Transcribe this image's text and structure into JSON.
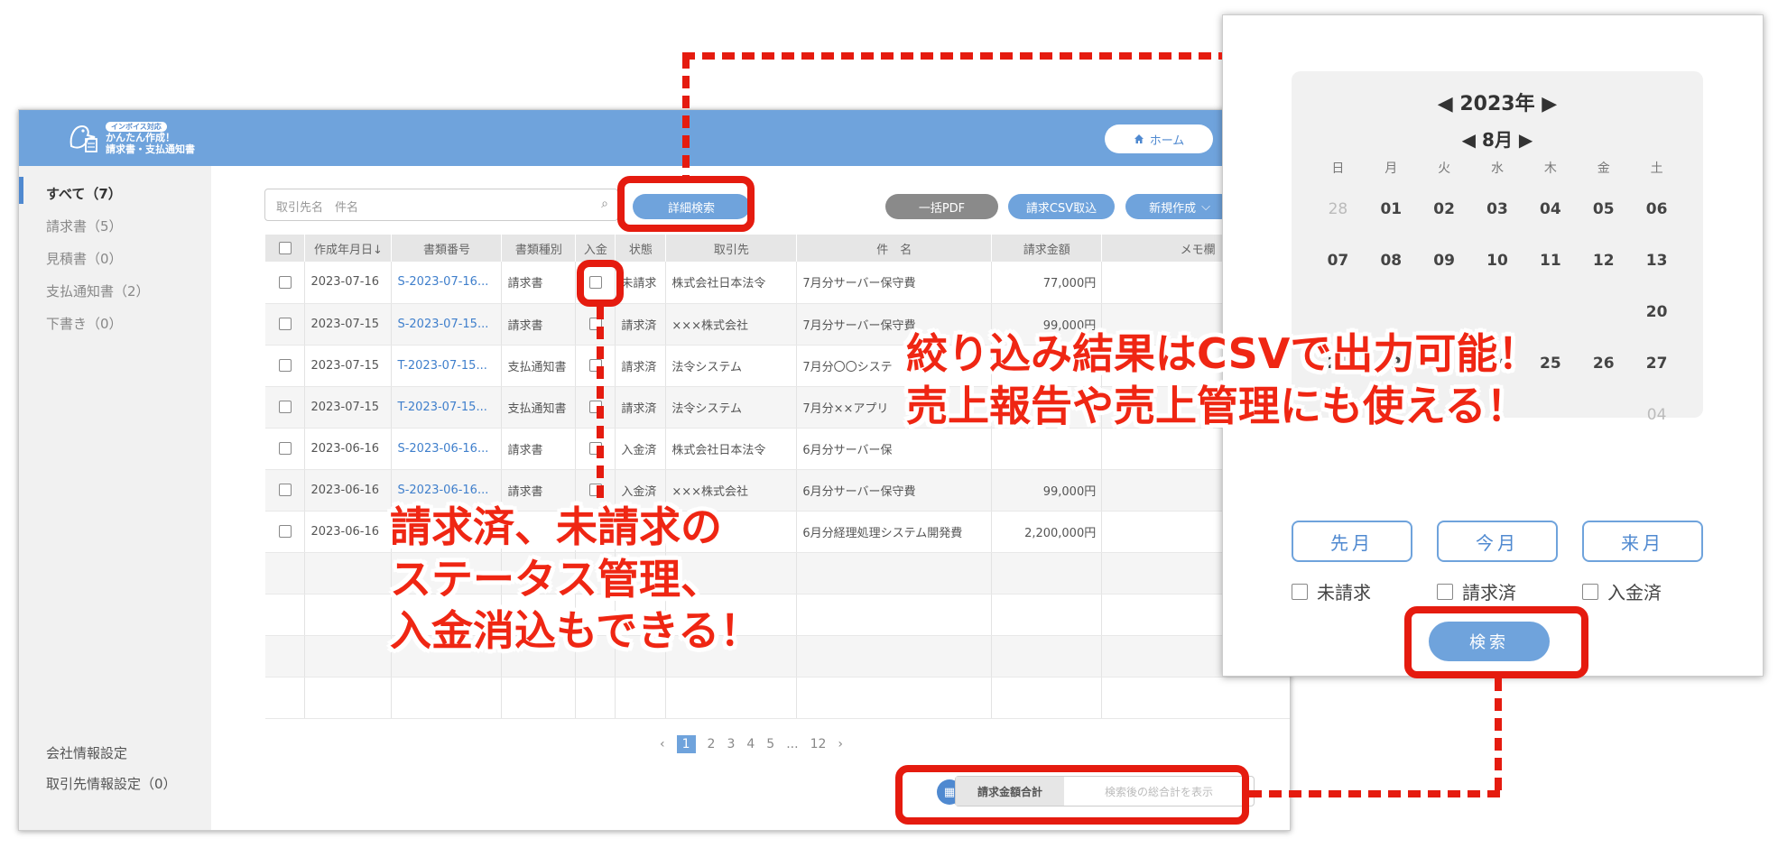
{
  "header": {
    "logo_badge": "インボイス対応",
    "logo_line1": "かんたん作成！",
    "logo_line2": "請求書・支払通知書",
    "home_label": "ホーム"
  },
  "sidebar": {
    "items": [
      "すべて（7）",
      "請求書（5）",
      "見積書（0）",
      "支払通知書（2）",
      "下書き（0）"
    ],
    "bottom": [
      "会社情報設定",
      "取引先情報設定（0）"
    ]
  },
  "toolbar": {
    "search_placeholder": "取引先名　件名",
    "detail_search": "詳細検索",
    "bulk_pdf": "一括PDF",
    "csv_import": "請求CSV取込",
    "new_create": "新規作成"
  },
  "table": {
    "headers": [
      "",
      "作成年月日",
      "書類番号",
      "書類種別",
      "入金",
      "状態",
      "取引先",
      "件　名",
      "請求金額",
      "メモ欄"
    ],
    "rows": [
      {
        "date": "2023-07-16",
        "no": "S-2023-07-16...",
        "type": "請求書",
        "status": "未請求",
        "client": "株式会社日本法令",
        "subject": "7月分サーバー保守費",
        "amount": "77,000円"
      },
      {
        "date": "2023-07-15",
        "no": "S-2023-07-15...",
        "type": "請求書",
        "status": "請求済",
        "client": "×××株式会社",
        "subject": "7月分サーバー保守費",
        "amount": "99,000円"
      },
      {
        "date": "2023-07-15",
        "no": "T-2023-07-15...",
        "type": "支払通知書",
        "status": "請求済",
        "client": "法令システム",
        "subject": "7月分〇〇システ",
        "amount": ""
      },
      {
        "date": "2023-07-15",
        "no": "T-2023-07-15...",
        "type": "支払通知書",
        "status": "請求済",
        "client": "法令システム",
        "subject": "7月分××アプリ",
        "amount": ""
      },
      {
        "date": "2023-06-16",
        "no": "S-2023-06-16...",
        "type": "請求書",
        "status": "入金済",
        "client": "株式会社日本法令",
        "subject": "6月分サーバー保",
        "amount": ""
      },
      {
        "date": "2023-06-16",
        "no": "S-2023-06-16...",
        "type": "請求書",
        "status": "入金済",
        "client": "×××株式会社",
        "subject": "6月分サーバー保守費",
        "amount": "99,000円"
      },
      {
        "date": "2023-06-16",
        "no": "",
        "type": "",
        "status": "",
        "client": "",
        "subject": "6月分経理処理システム開発費",
        "amount": "2,200,000円"
      }
    ]
  },
  "pager": {
    "prev": "‹",
    "pages": [
      "1",
      "2",
      "3",
      "4",
      "5",
      "...",
      "12"
    ],
    "next": "›"
  },
  "total": {
    "label": "請求金額合計",
    "placeholder": "検索後の総合計を表示"
  },
  "calendar": {
    "year": "2023年",
    "month": "8月",
    "weekdays": [
      "日",
      "月",
      "火",
      "水",
      "木",
      "金",
      "土"
    ],
    "rows": [
      [
        "28",
        "01",
        "02",
        "03",
        "04",
        "05",
        "06"
      ],
      [
        "07",
        "08",
        "09",
        "10",
        "11",
        "12",
        "13"
      ],
      [
        "",
        "",
        "",
        "",
        "",
        "",
        "20"
      ],
      [
        "21",
        "22",
        "23",
        "24",
        "25",
        "26",
        "27"
      ],
      [
        "",
        "",
        "",
        "",
        "",
        "",
        "04"
      ]
    ],
    "prev_month": "先月",
    "this_month": "今月",
    "next_month": "来月",
    "status_checks": [
      "未請求",
      "請求済",
      "入金済"
    ],
    "search": "検索"
  },
  "callouts": {
    "csv": "絞り込み結果はCSVで出力可能！\n売上報告や売上管理にも使える！",
    "status": "請求済、未請求の\nステータス管理、\n入金消込もできる！"
  },
  "colors": {
    "accent": "#6fa3dc",
    "highlight": "#e51b0f",
    "callout_text": "#ef2613"
  }
}
